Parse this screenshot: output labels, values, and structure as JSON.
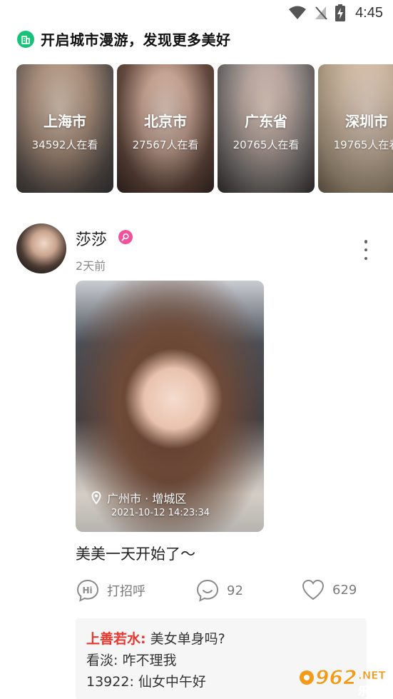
{
  "status_bar": {
    "time": "4:45",
    "icons": [
      "wifi-icon",
      "no-signal-icon",
      "battery-charging-icon"
    ]
  },
  "section": {
    "icon": "building-icon",
    "title": "开启城市漫游，发现更多美好"
  },
  "city_cards": [
    {
      "name": "上海市",
      "viewers": "34592人在看"
    },
    {
      "name": "北京市",
      "viewers": "27567人在看"
    },
    {
      "name": "广东省",
      "viewers": "20765人在看"
    },
    {
      "name": "深圳市",
      "viewers": "19765人在看"
    }
  ],
  "post": {
    "username": "莎莎",
    "badge_icon": "verified-search-icon",
    "time_ago": "2天前",
    "photo": {
      "location": "广州市 · 增城区",
      "datetime": "2021-10-12  14:23:34"
    },
    "caption": "美美一天开始了～",
    "actions": {
      "greet_label": "打招呼",
      "comment_count": "92",
      "like_count": "629"
    },
    "comments": [
      {
        "author": "上善若水:",
        "text": "美女单身吗?",
        "highlight": true
      },
      {
        "author": "看淡:",
        "text": "咋不理我",
        "highlight": false
      },
      {
        "author": "13922:",
        "text": "仙女中午好",
        "highlight": false
      }
    ]
  },
  "watermark": {
    "brand": "962",
    "suffix": ".NET",
    "sub": "乐游网"
  },
  "colors": {
    "accent_green": "#19c27a",
    "badge_pink": "#f0529c",
    "comment_highlight": "#e8372c",
    "watermark_orange": "#f39a1a"
  }
}
